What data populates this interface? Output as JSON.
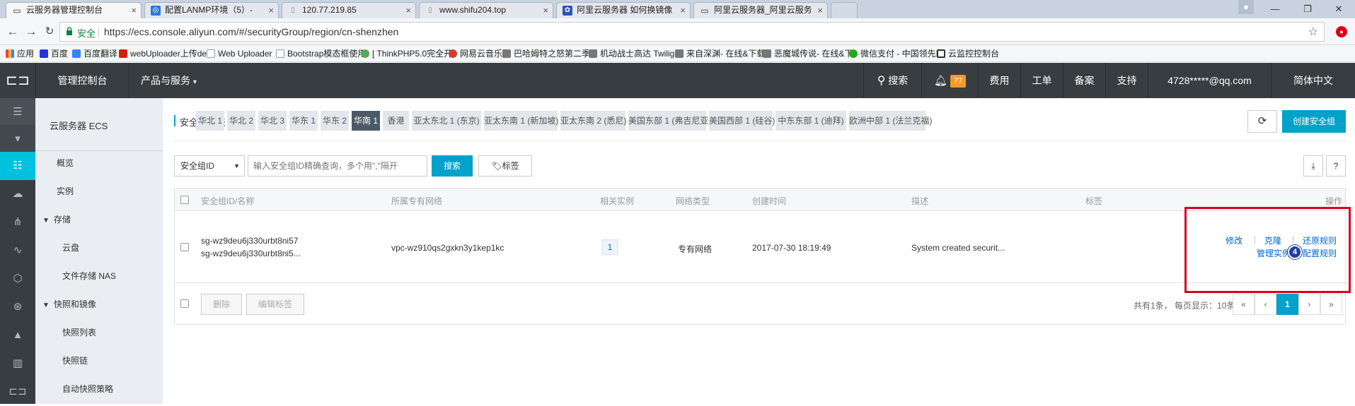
{
  "browser": {
    "tabs": [
      {
        "title": "云服务器管理控制台",
        "active": true,
        "color": "#333333",
        "glyph": "▭"
      },
      {
        "title": "配置LANMP环境（5）-",
        "active": false,
        "color": "#2b7bd6",
        "glyph": "◎"
      },
      {
        "title": "120.77.219.85",
        "active": false,
        "color": "#888888",
        "glyph": "▯"
      },
      {
        "title": "www.shifu204.top",
        "active": false,
        "color": "#888888",
        "glyph": "▯"
      },
      {
        "title": "阿里云服务器 如何换镜像",
        "active": false,
        "color": "#2a55b4",
        "glyph": "✿"
      },
      {
        "title": "阿里云服务器_阿里云服务",
        "active": false,
        "color": "#333333",
        "glyph": "▭"
      }
    ],
    "secure_label": "安全",
    "url": "https://ecs.console.aliyun.com/#/securityGroup/region/cn-shenzhen",
    "bookmarks": [
      {
        "label": "应用",
        "color": "#e8453c"
      },
      {
        "label": "百度",
        "color": "#2932e1"
      },
      {
        "label": "百度翻译",
        "color": "#3385ff"
      },
      {
        "label": "webUploader上传de",
        "color": "#d81e06"
      },
      {
        "label": "Web Uploader",
        "color": "#999999"
      },
      {
        "label": "Bootstrap模态框使用",
        "color": "#999999"
      },
      {
        "label": "[ ThinkPHP5.0完全开",
        "color": "#55aa55"
      },
      {
        "label": "网易云音乐",
        "color": "#d43c33"
      },
      {
        "label": "巴哈姆特之怒第二季-",
        "color": "#777777"
      },
      {
        "label": "机动战士高达 Twiligh",
        "color": "#777777"
      },
      {
        "label": "来自深渊- 在线&下载",
        "color": "#777777"
      },
      {
        "label": "恶魔城传说- 在线&下",
        "color": "#777777"
      },
      {
        "label": "微信支付 - 中国领先的",
        "color": "#1aad19"
      },
      {
        "label": "云监控控制台",
        "color": "#333333"
      }
    ]
  },
  "topnav": {
    "console": "管理控制台",
    "products": "产品与服务",
    "search": "搜索",
    "notif_count": "77",
    "fees": "费用",
    "tickets": "工单",
    "beian": "备案",
    "support": "支持",
    "account": "4728*****@qq.com",
    "lang": "简体中文"
  },
  "sidebar": {
    "title": "云服务器 ECS",
    "items": [
      "概览",
      "实例",
      "存储",
      "云盘",
      "文件存储 NAS",
      "快照和镜像",
      "快照列表",
      "快照链",
      "自动快照策略"
    ]
  },
  "main": {
    "list_title": "安全组列表",
    "regions": [
      "华北 1",
      "华北 2",
      "华北 3",
      "华东 1",
      "华东 2",
      "华南 1",
      "香港",
      "亚太东北 1 (东京)",
      "亚太东南 1 (新加坡)",
      "亚太东南 2 (悉尼)",
      "美国东部 1 (弗吉尼亚)",
      "美国西部 1 (硅谷)",
      "中东东部 1 (迪拜)",
      "欧洲中部 1 (法兰克福)"
    ],
    "active_region": "华南 1",
    "create_button": "创建安全组",
    "filter_select": "安全组ID",
    "search_placeholder": "输入安全组ID精确查询，多个用\",\"隔开",
    "search_button": "搜索",
    "tag_button": "标签",
    "columns": [
      "安全组ID/名称",
      "所属专有网络",
      "相关实例",
      "网络类型",
      "创建时间",
      "描述",
      "标签",
      "操作"
    ],
    "row": {
      "id": "sg-wz9deu6j330urbt8ni57",
      "name": "sg-wz9deu6j330urbt8ni5...",
      "vpc": "vpc-wz910qs2gxkn3y1kep1kc",
      "instances": "1",
      "network": "专有网络",
      "created": "2017-07-30 18:19:49",
      "desc": "System created securit...",
      "actions": {
        "edit": "修改",
        "clone": "克隆",
        "restore": "还原规则",
        "manage": "管理实例",
        "configure": "配置规则"
      },
      "badge": "4"
    },
    "delete_button": "删除",
    "edit_tags_button": "编辑标签",
    "pagination_info": "共有1条， 每页显示：10条",
    "pagination": {
      "first": "«",
      "prev": "‹",
      "current": "1",
      "next": "›",
      "last": "»"
    },
    "accent_color": "#00a2ca",
    "highlight_color": "#d9001b"
  }
}
